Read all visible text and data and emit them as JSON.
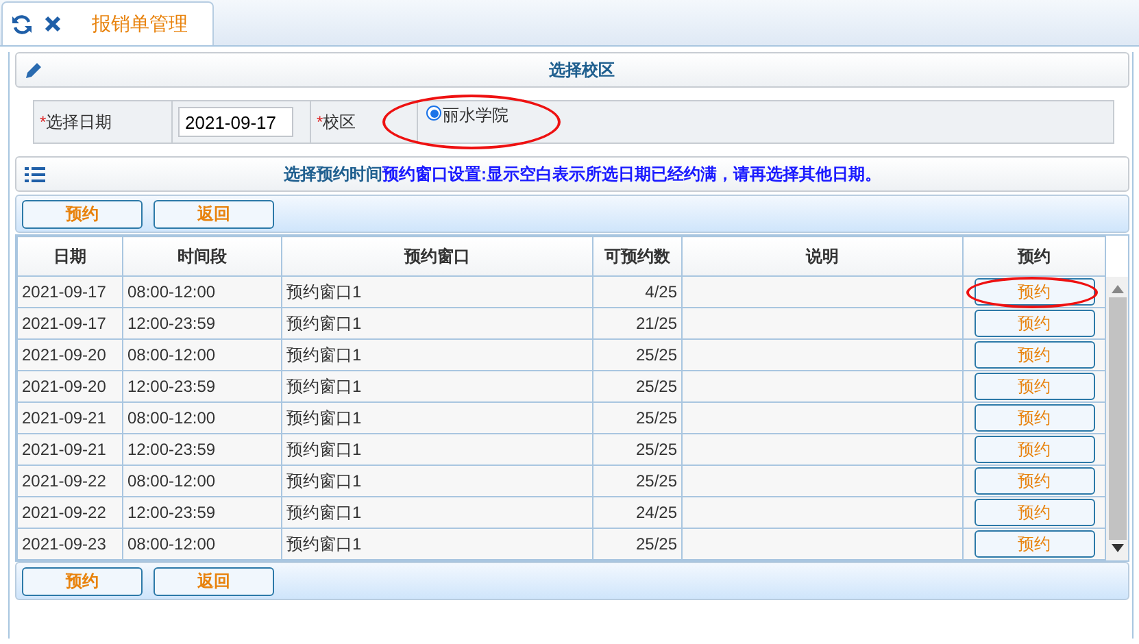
{
  "tab": {
    "title": "报销单管理",
    "selected": true
  },
  "campus_panel": {
    "title": "选择校区",
    "date_label": "选择日期",
    "date_required": "*",
    "date_value": "2021-09-17",
    "campus_label": "校区",
    "campus_required": "*",
    "options": [
      {
        "label": "丽水学院",
        "selected": true,
        "circled": true
      }
    ]
  },
  "slot_panel": {
    "title": "选择预约时间",
    "note": "预约窗口设置:显示空白表示所选日期已经约满，请再选择其他日期。",
    "top_buttons": [
      "预约",
      "返回"
    ],
    "columns": [
      "日期",
      "时间段",
      "预约窗口",
      "可预约数",
      "说明",
      "预约"
    ],
    "rows": [
      {
        "date": "2021-09-17",
        "time": "08:00-12:00",
        "window": "预约窗口1",
        "available": "4/25",
        "action": "预约",
        "circled": true
      },
      {
        "date": "2021-09-17",
        "time": "12:00-23:59",
        "window": "预约窗口1",
        "available": "21/25",
        "action": "预约",
        "circled": false
      },
      {
        "date": "2021-09-20",
        "time": "08:00-12:00",
        "window": "预约窗口1",
        "available": "25/25",
        "action": "预约",
        "circled": false
      },
      {
        "date": "2021-09-20",
        "time": "12:00-23:59",
        "window": "预约窗口1",
        "available": "25/25",
        "action": "预约",
        "circled": false
      },
      {
        "date": "2021-09-21",
        "time": "08:00-12:00",
        "window": "预约窗口1",
        "available": "25/25",
        "action": "预约",
        "circled": false
      },
      {
        "date": "2021-09-21",
        "time": "12:00-23:59",
        "window": "预约窗口1",
        "available": "25/25",
        "action": "预约",
        "circled": false
      },
      {
        "date": "2021-09-22",
        "time": "08:00-12:00",
        "window": "预约窗口1",
        "available": "25/25",
        "action": "预约",
        "circled": false
      },
      {
        "date": "2021-09-22",
        "time": "12:00-23:59",
        "window": "预约窗口1",
        "available": "24/25",
        "action": "预约",
        "circled": false
      },
      {
        "date": "2021-09-23",
        "time": "08:00-12:00",
        "window": "预约窗口1",
        "available": "25/25",
        "action": "预约",
        "circled": false
      }
    ],
    "bottom_buttons": [
      "预约",
      "返回"
    ]
  }
}
